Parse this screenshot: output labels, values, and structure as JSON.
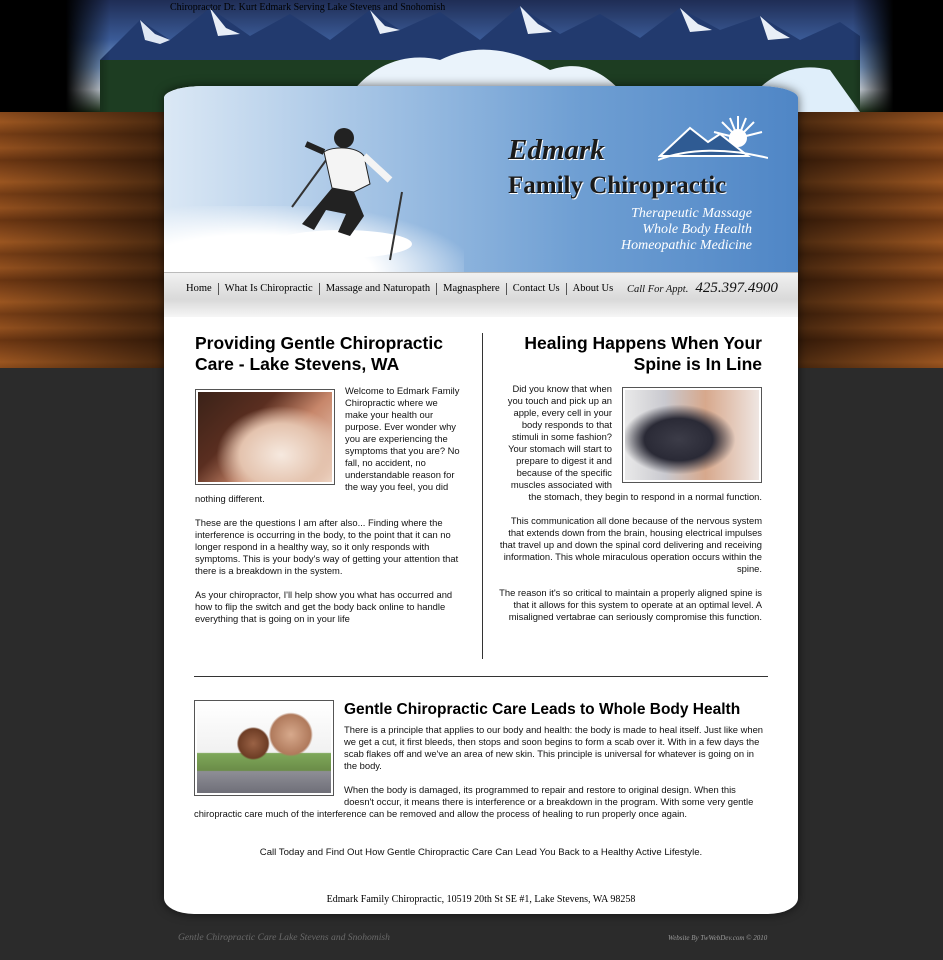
{
  "top_tagline": "Chiropractor Dr. Kurt Edmark Serving Lake Stevens and Snohomish",
  "logo": {
    "line1": "Edmark",
    "line2": "Family Chiropractic",
    "services": [
      "Therapeutic Massage",
      "Whole Body Health",
      "Homeopathic Medicine"
    ]
  },
  "nav": {
    "items": [
      "Home",
      "What Is Chiropractic",
      "Massage and Naturopath",
      "Magnasphere",
      "Contact Us",
      "About Us"
    ],
    "call_label": "Call For Appt.",
    "phone": "425.397.4900"
  },
  "left": {
    "title": "Providing Gentle Chiropractic Care - Lake Stevens, WA",
    "paragraphs": [
      "Welcome to Edmark Family Chiropractic where we make your health our purpose.  Ever wonder why you are experiencing the symptoms that you are? No fall, no accident, no understandable reason for the way you feel, you did nothing different.",
      "These are the questions I am after also...  Finding where the interference is occurring in the body, to the point that it can no longer respond in a healthy way, so it only responds with symptoms.  This is your body's way of getting your attention that there is a breakdown in the system.",
      "As your chiropractor, I'll help show you what has occurred and how to flip the switch and get the body back online to handle everything that is going on in your life"
    ]
  },
  "right": {
    "title": "Healing Happens When Your Spine is In Line",
    "paragraphs": [
      "Did you know that when you touch and pick up an apple, every cell in your body responds to that stimuli in some fashion?  Your stomach will start to prepare to digest it and because of the specific muscles associated with the stomach, they begin to respond in a normal function.",
      "This communication all done because of the nervous system that extends down from the brain, housing electrical impulses that travel up and down the spinal cord delivering and receiving information.  This whole miraculous operation occurs within the spine.",
      "The reason it's so critical to maintain a properly aligned spine is that it allows for this system to operate at an optimal level.  A misaligned vertabrae can seriously compromise this function."
    ]
  },
  "bottom": {
    "title": "Gentle Chiropractic Care Leads to Whole Body Health",
    "paragraphs": [
      "There is a principle that applies to our body and health: the body is made to heal itself.  Just like when we get a cut, it first bleeds, then stops and soon begins to form a scab over it.  With in a few days the scab flakes off and we've an area of new skin.  This principle is universal for whatever is going on in the body.",
      "When the body is damaged,  its programmed to repair and restore to original design.  When this doesn't occur, it means there is interference or a breakdown in the program.  With some very gentle chiropractic care much of the interference can be removed and allow the process of healing to run properly once again."
    ]
  },
  "cta": "Call Today and Find Out How Gentle Chiropractic Care Can Lead You Back to a Healthy Active Lifestyle.",
  "address": "Edmark Family Chiropractic, 10519 20th St SE #1, Lake Stevens, WA 98258",
  "footer": {
    "left": "Gentle Chiropractic Care Lake Stevens and Snohomish",
    "right": "Website By TwWebDev.com © 2010"
  }
}
